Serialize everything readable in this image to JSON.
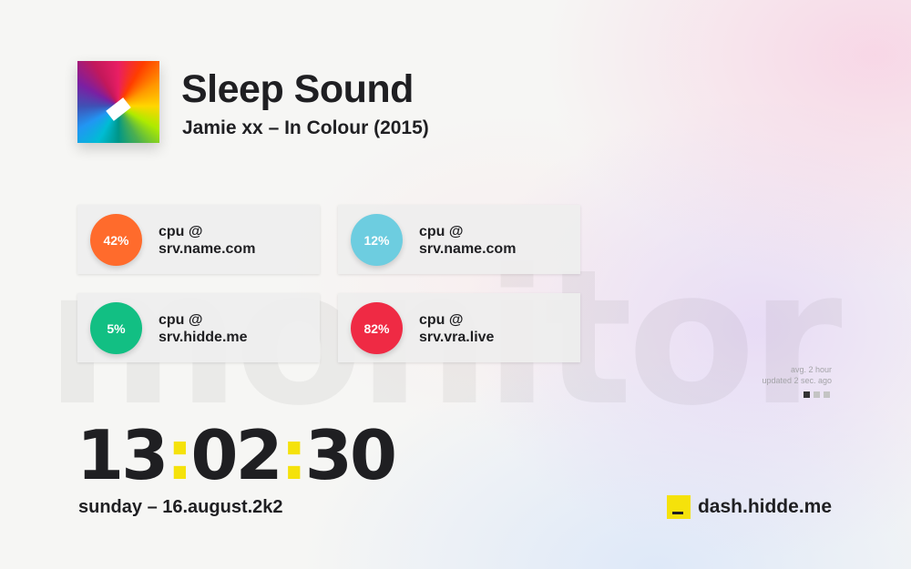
{
  "background_word": "monitor",
  "now_playing": {
    "title": "Sleep Sound",
    "meta": "Jamie xx – In Colour (2015)"
  },
  "cards": [
    {
      "percent": "42%",
      "line1": "cpu @",
      "line2": "srv.name.com",
      "color": "#ff6b2c"
    },
    {
      "percent": "12%",
      "line1": "cpu @",
      "line2": "srv.name.com",
      "color": "#6dcde0"
    },
    {
      "percent": "5%",
      "line1": "cpu @",
      "line2": "srv.hidde.me",
      "color": "#12bf83"
    },
    {
      "percent": "82%",
      "line1": "cpu @",
      "line2": "srv.vra.live",
      "color": "#ef2a44"
    }
  ],
  "stats": {
    "avg": "avg. 2 hour",
    "updated": "updated 2 sec. ago"
  },
  "pager": {
    "total": 3,
    "active": 1
  },
  "clock": {
    "hours": "13",
    "minutes": "02",
    "seconds": "30",
    "separator": ":"
  },
  "date": "sunday – 16.august.2k2",
  "brand": {
    "name": "dash.hidde.me"
  },
  "colors": {
    "accent": "#f5e20b",
    "text": "#1f1f22"
  }
}
